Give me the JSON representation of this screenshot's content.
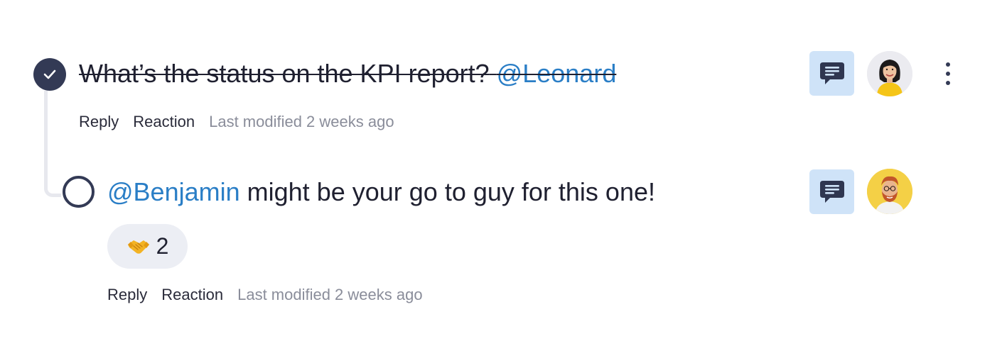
{
  "colors": {
    "accent_dark": "#333a55",
    "mention": "#2a7ec6",
    "comment_button_bg": "#cfe3f8",
    "muted_text": "#8a8d9a"
  },
  "comments": [
    {
      "status": "resolved",
      "status_icon": "checkmark-icon",
      "text": "What’s the status on the KPI report?",
      "mention": "@Leonard",
      "actions": {
        "reply": "Reply",
        "reaction": "Reaction"
      },
      "timestamp": "Last modified 2 weeks ago",
      "comment_icon": "chat-bubble-icon",
      "avatar": "woman-avatar",
      "menu_icon": "vertical-ellipsis-icon"
    },
    {
      "status": "open",
      "status_icon": "empty-circle-icon",
      "mention": "@Benjamin",
      "text": "might be your go to guy for this one!",
      "reaction": {
        "emoji": "🤝",
        "count": "2"
      },
      "actions": {
        "reply": "Reply",
        "reaction": "Reaction"
      },
      "timestamp": "Last modified 2 weeks ago",
      "comment_icon": "chat-bubble-icon",
      "avatar": "man-avatar"
    }
  ]
}
